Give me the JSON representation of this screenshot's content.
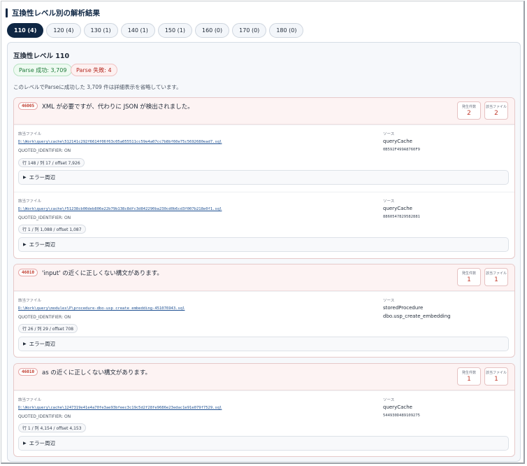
{
  "page_title": "互換性レベル別の解析結果",
  "tabs": [
    {
      "label": "110 (4)",
      "active": true
    },
    {
      "label": "120 (4)",
      "active": false
    },
    {
      "label": "130 (1)",
      "active": false
    },
    {
      "label": "140 (1)",
      "active": false
    },
    {
      "label": "150 (1)",
      "active": false
    },
    {
      "label": "160 (0)",
      "active": false
    },
    {
      "label": "170 (0)",
      "active": false
    },
    {
      "label": "180 (0)",
      "active": false
    }
  ],
  "level": {
    "title": "互換性レベル 110",
    "parse_success": "Parse 成功: 3,709",
    "parse_fail": "Parse 失敗: 4",
    "note": "このレベルでParseに成功した 3,709 件は詳細表示を省略しています。"
  },
  "labels": {
    "file": "該当ファイル",
    "source": "ソース",
    "occurrences": "発生件数",
    "files": "該当ファイル",
    "expander": "エラー周辺"
  },
  "errors": [
    {
      "code": "46005",
      "message": "XML が必要ですが、代わりに JSON が検出されました。",
      "occurrences": "2",
      "files": "2",
      "entries": [
        {
          "path": "D:\\Work\\query\\cache\\512141c292f6614f06f63c05a055511cc59e4a07cc7b8bf60e75c5692680ead7.sql",
          "qi": "QUOTED_IDENTIFIER: ON",
          "position": "行 148 / 列 17 / offset 7,926",
          "source_type": "queryCache",
          "source_detail": "0B592F499A8760F9"
        },
        {
          "path": "D:\\Work\\query\\cache\\f51238cb00deb806e22b79b138c8dfc3d842290ba230cd0b6cd3f007b218e0f1.sql",
          "qi": "QUOTED_IDENTIFIER: ON",
          "position": "行 1 / 列 1,088 / offset 1,087",
          "source_type": "queryCache",
          "source_detail": "8860547829582881"
        }
      ]
    },
    {
      "code": "46010",
      "message": "'input' の近くに正しくない構文があります。",
      "occurrences": "1",
      "files": "1",
      "entries": [
        {
          "path": "D:\\Work\\query\\modules\\P\\procedure-dbo-usp_create_embedding-451076943.sql",
          "qi": "QUOTED_IDENTIFIER: ON",
          "position": "行 26 / 列 29 / offset 708",
          "source_type": "storedProcedure",
          "source_detail": "dbo.usp_create_embedding"
        }
      ]
    },
    {
      "code": "46010",
      "message": "as の近くに正しくない構文があります。",
      "occurrences": "1",
      "files": "1",
      "entries": [
        {
          "path": "D:\\Work\\query\\cache\\1247319e41e4a70fe3ae93bfeec3c19c5d2f28fe9686e23edac1e91e079f7529.sql",
          "qi": "QUOTED_IDENTIFIER: ON",
          "position": "行 1 / 列 4,154 / offset 4,153",
          "source_type": "queryCache",
          "source_detail": "544930D489109275"
        }
      ]
    }
  ]
}
